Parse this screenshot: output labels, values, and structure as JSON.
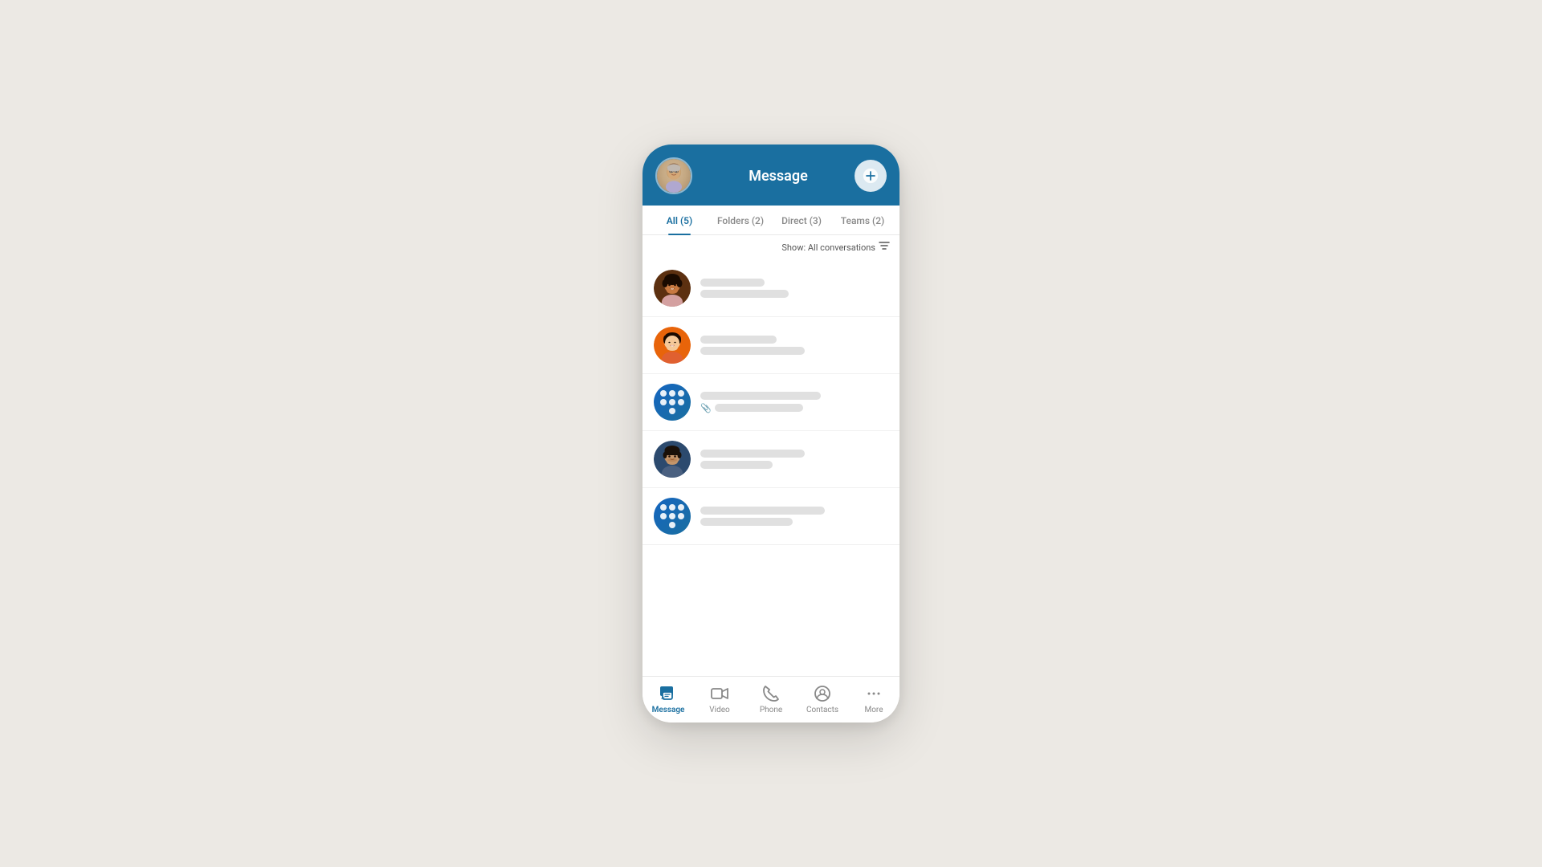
{
  "header": {
    "title": "Message",
    "add_button_label": "+"
  },
  "tabs": [
    {
      "label": "All (5)",
      "active": true
    },
    {
      "label": "Folders (2)",
      "active": false
    },
    {
      "label": "Direct (3)",
      "active": false
    },
    {
      "label": "Teams (2)",
      "active": false
    }
  ],
  "filter": {
    "label": "Show: All conversations"
  },
  "conversations": [
    {
      "id": 1,
      "avatar_type": "person1",
      "name_width": 80,
      "msg_width": 110
    },
    {
      "id": 2,
      "avatar_type": "person2",
      "name_width": 95,
      "msg_width": 130
    },
    {
      "id": 3,
      "avatar_type": "app1",
      "name_width": 140,
      "msg_width": 110,
      "has_attachment": true
    },
    {
      "id": 4,
      "avatar_type": "person4",
      "name_width": 120,
      "msg_width": 90
    },
    {
      "id": 5,
      "avatar_type": "app2",
      "name_width": 150,
      "msg_width": 110
    }
  ],
  "bottom_nav": [
    {
      "id": "message",
      "label": "Message",
      "active": true,
      "icon": "message"
    },
    {
      "id": "video",
      "label": "Video",
      "active": false,
      "icon": "video"
    },
    {
      "id": "phone",
      "label": "Phone",
      "active": false,
      "icon": "phone"
    },
    {
      "id": "contacts",
      "label": "Contacts",
      "active": false,
      "icon": "contacts"
    },
    {
      "id": "more",
      "label": "More",
      "active": false,
      "icon": "more"
    }
  ],
  "colors": {
    "header_bg": "#1a6fa0",
    "active_tab": "#1a6fa0",
    "active_nav": "#1a6fa0"
  }
}
